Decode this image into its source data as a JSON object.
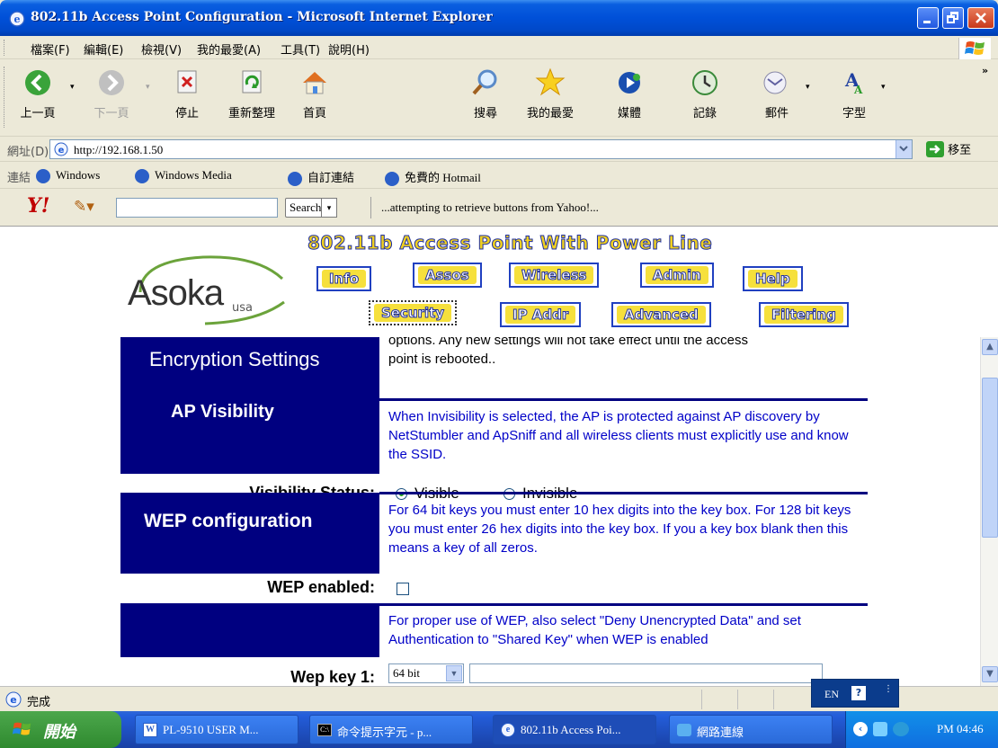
{
  "window": {
    "title": "802.11b Access Point Configuration - Microsoft Internet Explorer"
  },
  "menu": [
    "檔案(F)",
    "編輯(E)",
    "檢視(V)",
    "我的最愛(A)",
    "工具(T)",
    "說明(H)"
  ],
  "toolbar": {
    "back": "上一頁",
    "forward": "下一頁",
    "stop": "停止",
    "refresh": "重新整理",
    "home": "首頁",
    "search": "搜尋",
    "favorites": "我的最愛",
    "media": "媒體",
    "history": "記錄",
    "mail": "郵件",
    "font": "字型"
  },
  "address": {
    "label": "網址(D)",
    "url": "http://192.168.1.50",
    "go": "移至"
  },
  "links": {
    "label": "連結",
    "items": [
      "Windows",
      "Windows Media",
      "自訂連結",
      "免費的 Hotmail"
    ]
  },
  "yahoo": {
    "search_label": "Search",
    "status": "...attempting to retrieve buttons from Yahoo!..."
  },
  "page": {
    "header": "802.11b Access Point With Power Line",
    "logo": "Asoka",
    "logo_sub": "usa",
    "nav_row1": [
      "Info",
      "Assos",
      "Wireless",
      "Admin",
      "Help"
    ],
    "nav_row2": [
      "Security",
      "IP Addr",
      "Advanced",
      "Filtering"
    ],
    "encryption": {
      "title": "Encryption Settings",
      "desc_top": "options. Any new settings will not take effect until the access",
      "desc_bottom": "point is rebooted.."
    },
    "visibility": {
      "title": "AP Visibility",
      "desc": "When Invisibility is selected, the AP is protected against AP discovery by NetStumbler and ApSniff and all wireless clients must explicitly use and know the SSID.",
      "status_label": "Visibility Status:",
      "option_visible": "Visible",
      "option_invisible": "Invisible",
      "selected": "Visible"
    },
    "wep": {
      "title": "WEP configuration",
      "desc": "For 64 bit keys you must enter 10 hex digits into the key box. For 128 bit keys you must enter 26 hex digits into the key box. If you a key box blank then this means a key of all zeros.",
      "enabled_label": "WEP enabled:",
      "enabled": false,
      "note": "For proper use of WEP, also select \"Deny Unencrypted Data\" and set Authentication to \"Shared Key\" when WEP is enabled",
      "key1_label": "Wep key 1:",
      "key1_size": "64 bit",
      "key1_value": ""
    }
  },
  "status": {
    "text": "完成",
    "lang": "EN"
  },
  "taskbar": {
    "start": "開始",
    "tasks": [
      "PL-9510 USER M...",
      "命令提示字元 - p...",
      "802.11b Access Poi...",
      "網路連線"
    ],
    "clock": "PM 04:46"
  }
}
